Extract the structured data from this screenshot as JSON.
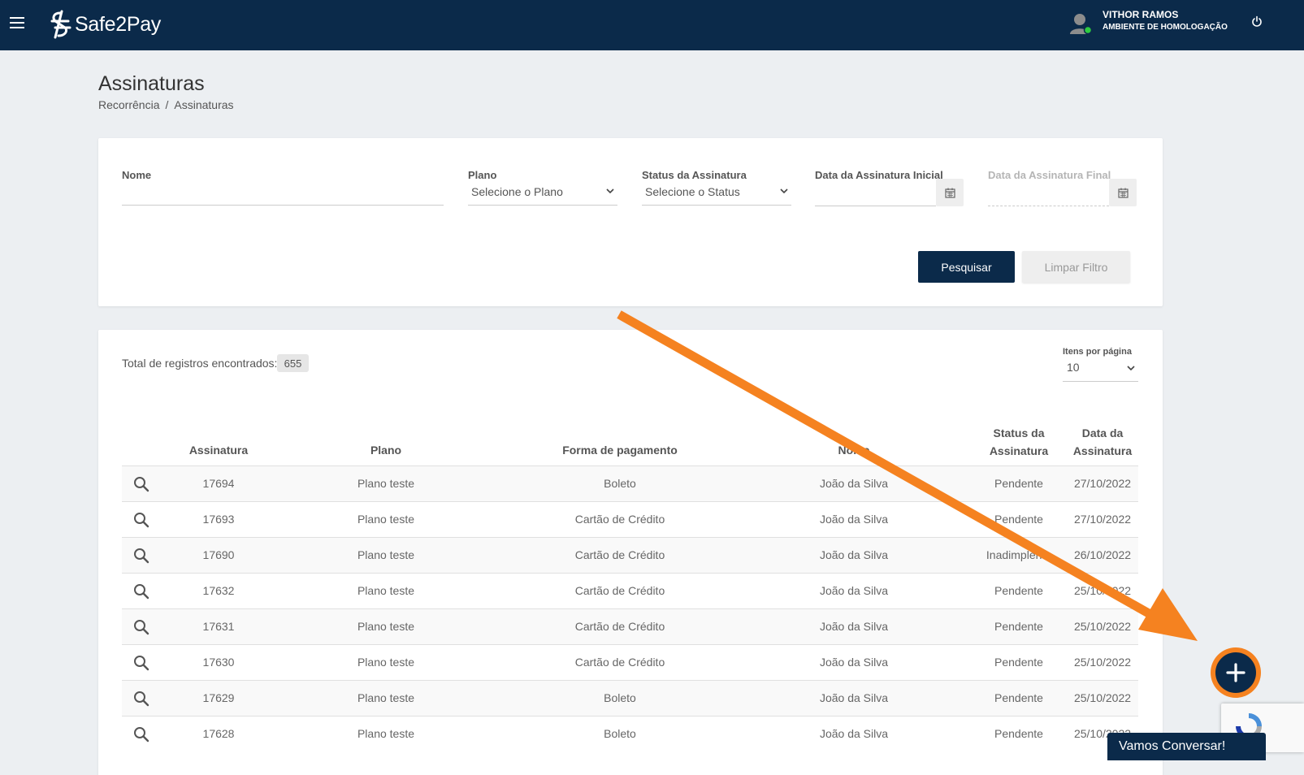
{
  "header": {
    "logo_text": "Safe2Pay",
    "user_name": "VITHOR RAMOS",
    "environment": "AMBIENTE DE HOMOLOGAÇÃO",
    "status_color": "#2ecc40"
  },
  "page": {
    "title": "Assinaturas",
    "breadcrumb": [
      "Recorrência",
      "Assinaturas"
    ],
    "breadcrumb_sep": "/"
  },
  "filters": {
    "nome_label": "Nome",
    "nome_value": "",
    "plano_label": "Plano",
    "plano_value": "Selecione o Plano",
    "status_label": "Status da Assinatura",
    "status_value": "Selecione o Status",
    "data_inicial_label": "Data da Assinatura Inicial",
    "data_final_label": "Data da Assinatura Final",
    "search_button": "Pesquisar",
    "clear_button": "Limpar Filtro"
  },
  "results": {
    "total_label": "Total de registros encontrados:",
    "total_count": "655",
    "per_page_label": "Itens por página",
    "per_page_value": "10",
    "columns": [
      "Assinatura",
      "Plano",
      "Forma de pagamento",
      "Nome",
      "Status da",
      "Assinatura",
      "Data da",
      "Assinatura"
    ],
    "rows": [
      {
        "id": "17694",
        "plano": "Plano teste",
        "forma": "Boleto",
        "nome": "João da Silva",
        "status": "Pendente",
        "data": "27/10/2022"
      },
      {
        "id": "17693",
        "plano": "Plano teste",
        "forma": "Cartão de Crédito",
        "nome": "João da Silva",
        "status": "Pendente",
        "data": "27/10/2022"
      },
      {
        "id": "17690",
        "plano": "Plano teste",
        "forma": "Cartão de Crédito",
        "nome": "João da Silva",
        "status": "Inadimplente",
        "data": "26/10/2022"
      },
      {
        "id": "17632",
        "plano": "Plano teste",
        "forma": "Cartão de Crédito",
        "nome": "João da Silva",
        "status": "Pendente",
        "data": "25/10/2022"
      },
      {
        "id": "17631",
        "plano": "Plano teste",
        "forma": "Cartão de Crédito",
        "nome": "João da Silva",
        "status": "Pendente",
        "data": "25/10/2022"
      },
      {
        "id": "17630",
        "plano": "Plano teste",
        "forma": "Cartão de Crédito",
        "nome": "João da Silva",
        "status": "Pendente",
        "data": "25/10/2022"
      },
      {
        "id": "17629",
        "plano": "Plano teste",
        "forma": "Boleto",
        "nome": "João da Silva",
        "status": "Pendente",
        "data": "25/10/2022"
      },
      {
        "id": "17628",
        "plano": "Plano teste",
        "forma": "Boleto",
        "nome": "João da Silva",
        "status": "Pendente",
        "data": "25/10/2022"
      }
    ]
  },
  "chat": {
    "label": "Vamos Conversar!"
  },
  "colors": {
    "navy": "#0b2a4a",
    "annotation_orange": "#f58220"
  }
}
